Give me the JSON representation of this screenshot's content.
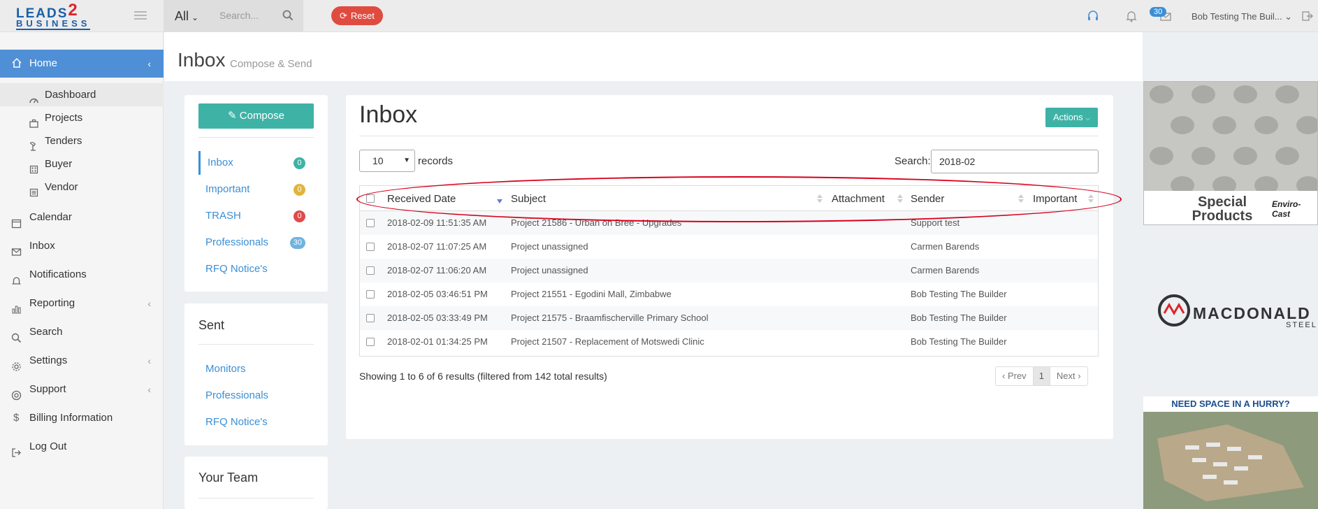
{
  "topbar": {
    "logo_top": "LEADS",
    "logo_two": "2",
    "logo_bottom": "BUSINESS",
    "scope": "All",
    "search_placeholder": "Search...",
    "reset_label": "Reset",
    "message_count": "30",
    "user_name": "Bob Testing The Buil..."
  },
  "sidebar": {
    "home": "Home",
    "sub_items": [
      "Dashboard",
      "Projects",
      "Tenders",
      "Buyer",
      "Vendor"
    ],
    "items": [
      "Calendar",
      "Inbox",
      "Notifications",
      "Reporting",
      "Search",
      "Settings",
      "Support",
      "Billing Information",
      "Log Out"
    ]
  },
  "page": {
    "title": "Inbox",
    "subtitle": "Compose & Send"
  },
  "mailbox": {
    "compose_label": "Compose",
    "folders": [
      {
        "label": "Inbox",
        "count": "0",
        "color": "#3fb2a6"
      },
      {
        "label": "Important",
        "count": "0",
        "color": "#e0b53a"
      },
      {
        "label": "TRASH",
        "count": "0",
        "color": "#e04b4b"
      },
      {
        "label": "Professionals",
        "count": "30",
        "color": "#6fb3e0"
      },
      {
        "label": "RFQ Notice's",
        "count": "",
        "color": ""
      }
    ],
    "sent_title": "Sent",
    "sent_items": [
      "Monitors",
      "Professionals",
      "RFQ Notice's"
    ],
    "team_title": "Your Team"
  },
  "inbox": {
    "heading": "Inbox",
    "actions_label": "Actions",
    "records_value": "10",
    "records_label": "records",
    "search_label": "Search:",
    "search_value": "2018-02",
    "columns": [
      "Received Date",
      "Subject",
      "Attachment",
      "Sender",
      "Important"
    ],
    "rows": [
      {
        "date": "2018-02-09 11:51:35 AM",
        "subject": "Project 21586 - Urban on Bree - Upgrades",
        "sender": "Support test"
      },
      {
        "date": "2018-02-07 11:07:25 AM",
        "subject": "Project unassigned",
        "sender": "Carmen Barends"
      },
      {
        "date": "2018-02-07 11:06:20 AM",
        "subject": "Project unassigned",
        "sender": "Carmen Barends"
      },
      {
        "date": "2018-02-05 03:46:51 PM",
        "subject": "Project 21551 - Egodini Mall, Zimbabwe",
        "sender": "Bob Testing The Builder"
      },
      {
        "date": "2018-02-05 03:33:49 PM",
        "subject": "Project 21575 - Braamfischerville Primary School",
        "sender": "Bob Testing The Builder"
      },
      {
        "date": "2018-02-01 01:34:25 PM",
        "subject": "Project 21507 - Replacement of Motswedi Clinic",
        "sender": "Bob Testing The Builder"
      }
    ],
    "showing": "Showing 1 to 6 of 6 results (filtered from 142 total results)",
    "pager": {
      "prev": "Prev",
      "page": "1",
      "next": "Next"
    }
  },
  "ads": {
    "ad1_title": "Special Products",
    "ad1_brand": "Enviro-Cast",
    "ad2_name": "MACDONALD",
    "ad2_sub": "STEEL",
    "ad3_title": "NEED SPACE IN A HURRY?"
  }
}
